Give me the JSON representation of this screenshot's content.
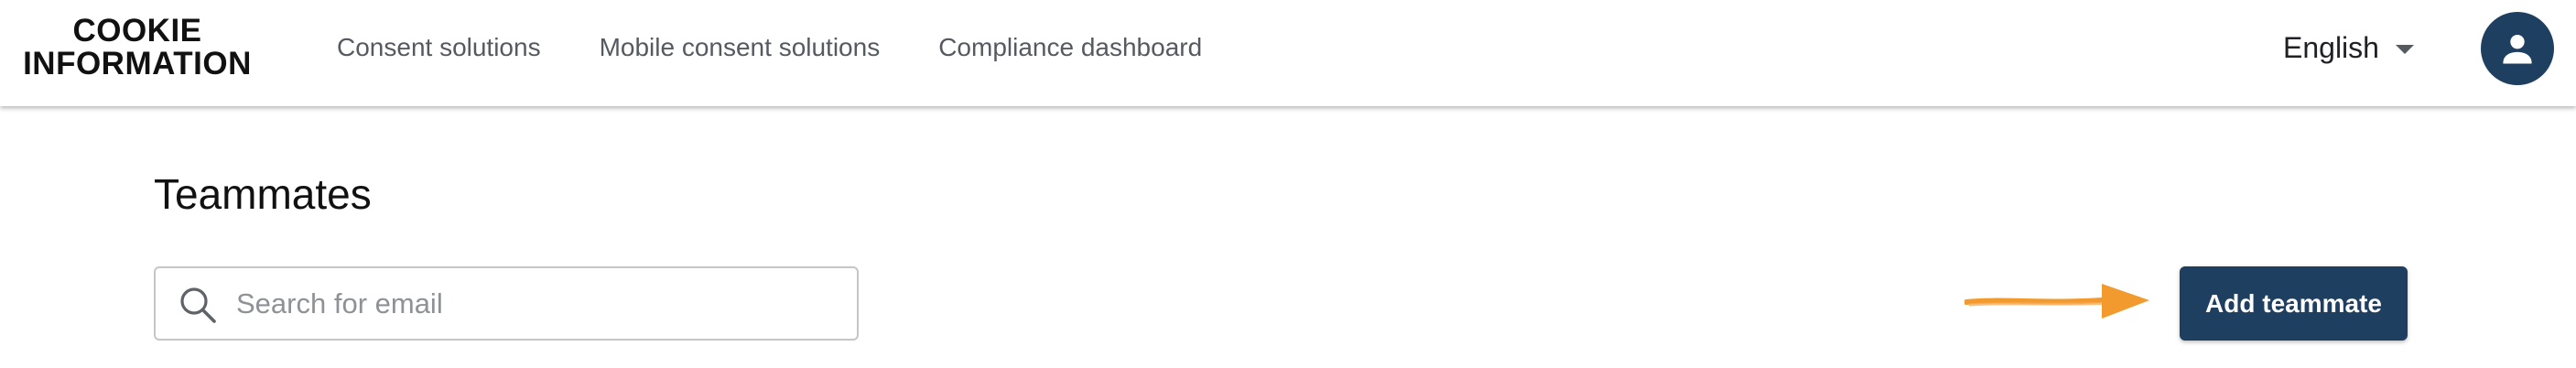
{
  "brand": {
    "line1": "COOKIE",
    "line2": "INFORMATION"
  },
  "nav": {
    "items": [
      {
        "label": "Consent solutions"
      },
      {
        "label": "Mobile consent solutions"
      },
      {
        "label": "Compliance dashboard"
      }
    ]
  },
  "language": {
    "selected": "English",
    "icon": "caret-down-icon"
  },
  "account": {
    "icon": "user-avatar-icon"
  },
  "page": {
    "title": "Teammates"
  },
  "search": {
    "placeholder": "Search for email",
    "value": "",
    "icon": "search-icon"
  },
  "annotation": {
    "icon": "arrow-right-icon",
    "color": "#f29a2e"
  },
  "actions": {
    "add_label": "Add teammate"
  },
  "colors": {
    "primary": "#1e3f5f",
    "nav_text": "#555a60",
    "border": "#c4c6c9"
  }
}
